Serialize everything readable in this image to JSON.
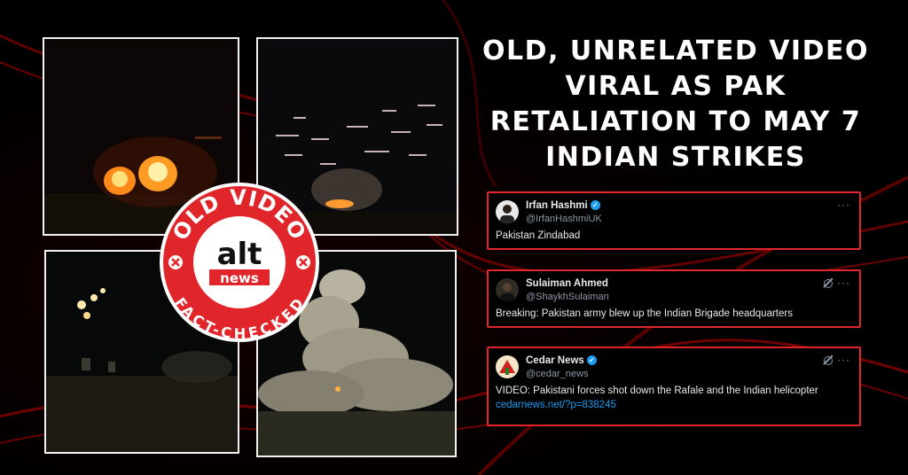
{
  "headline": "OLD, UNRELATED VIDEO VIRAL AS PAK RETALIATION TO MAY 7 INDIAN STRIKES",
  "badge": {
    "top_text": "OLD VIDEO",
    "logo_top": "alt",
    "logo_bottom": "news",
    "bottom_text": "FACT-CHECKED",
    "color": "#e0252b"
  },
  "tweets": [
    {
      "name": "Irfan Hashmi",
      "handle": "@IrfanHashmiUK",
      "verified": true,
      "text": "Pakistan Zindabad",
      "link": ""
    },
    {
      "name": "Sulaiman Ahmed",
      "handle": "@ShaykhSulaiman",
      "verified": false,
      "text": "Breaking: Pakistan army blew up the Indian Brigade headquarters",
      "link": ""
    },
    {
      "name": "Cedar News",
      "handle": "@cedar_news",
      "verified": true,
      "text": "VIDEO: Pakistani forces shot down the Rafale and the Indian helicopter",
      "link": "cedarnews.net/?p=838245"
    }
  ],
  "icons": {
    "more": "more-icon",
    "grok": "grok-icon",
    "verified": "verified-badge-icon"
  },
  "colors": {
    "accent": "#e0252b",
    "link": "#1d9bf0"
  }
}
